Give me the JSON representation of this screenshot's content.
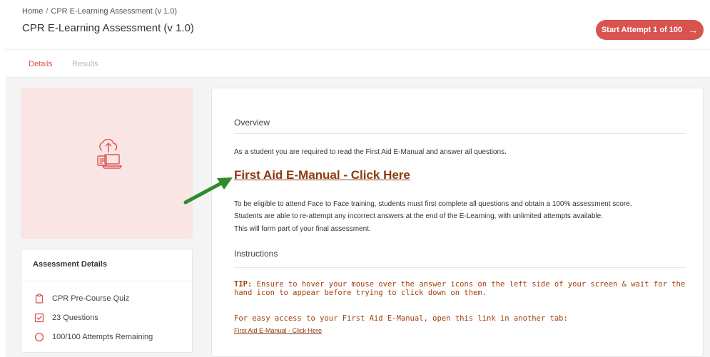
{
  "header": {
    "breadcrumb": {
      "home": "Home",
      "separator": "/",
      "current": "CPR E-Learning Assessment (v 1.0)"
    },
    "title": "CPR E-Learning Assessment (v 1.0)",
    "start_button": "Start Attempt 1 of 100"
  },
  "tabs": {
    "details": "Details",
    "results": "Results"
  },
  "details_card": {
    "title": "Assessment Details",
    "items": [
      {
        "icon": "clipboard-icon",
        "label": "CPR Pre-Course Quiz"
      },
      {
        "icon": "checkbox-icon",
        "label": "23 Questions"
      },
      {
        "icon": "circle-icon",
        "label": "100/100 Attempts Remaining"
      }
    ]
  },
  "content": {
    "overview_heading": "Overview",
    "intro": "As a student you are required to read the First Aid E-Manual and answer all questions.",
    "manual_link": "First Aid E-Manual - Click Here",
    "eligibility_1": "To be eligible to attend Face to Face training, students must first complete all questions and obtain a 100% assessment score.",
    "eligibility_2": "Students are able to re-attempt any incorrect answers at the end of the E-Learning, with unlimited attempts available.",
    "eligibility_3": "This will form part of your final assessment.",
    "instructions_heading": "Instructions",
    "tip_label": "TIP:",
    "tip_text": "Ensure to hover your mouse over the answer icons on the left side of your screen & wait for the hand icon to appear before trying to click down on them.",
    "easy_access": "For easy access to your First Aid E-Manual, open this link in another tab:",
    "small_link": "First Aid E-Manual - Click Here"
  },
  "colors": {
    "accent": "#d9534f",
    "link": "#8b3a0e",
    "tip": "#a0420b",
    "annotation_arrow": "#2e8b2e"
  }
}
